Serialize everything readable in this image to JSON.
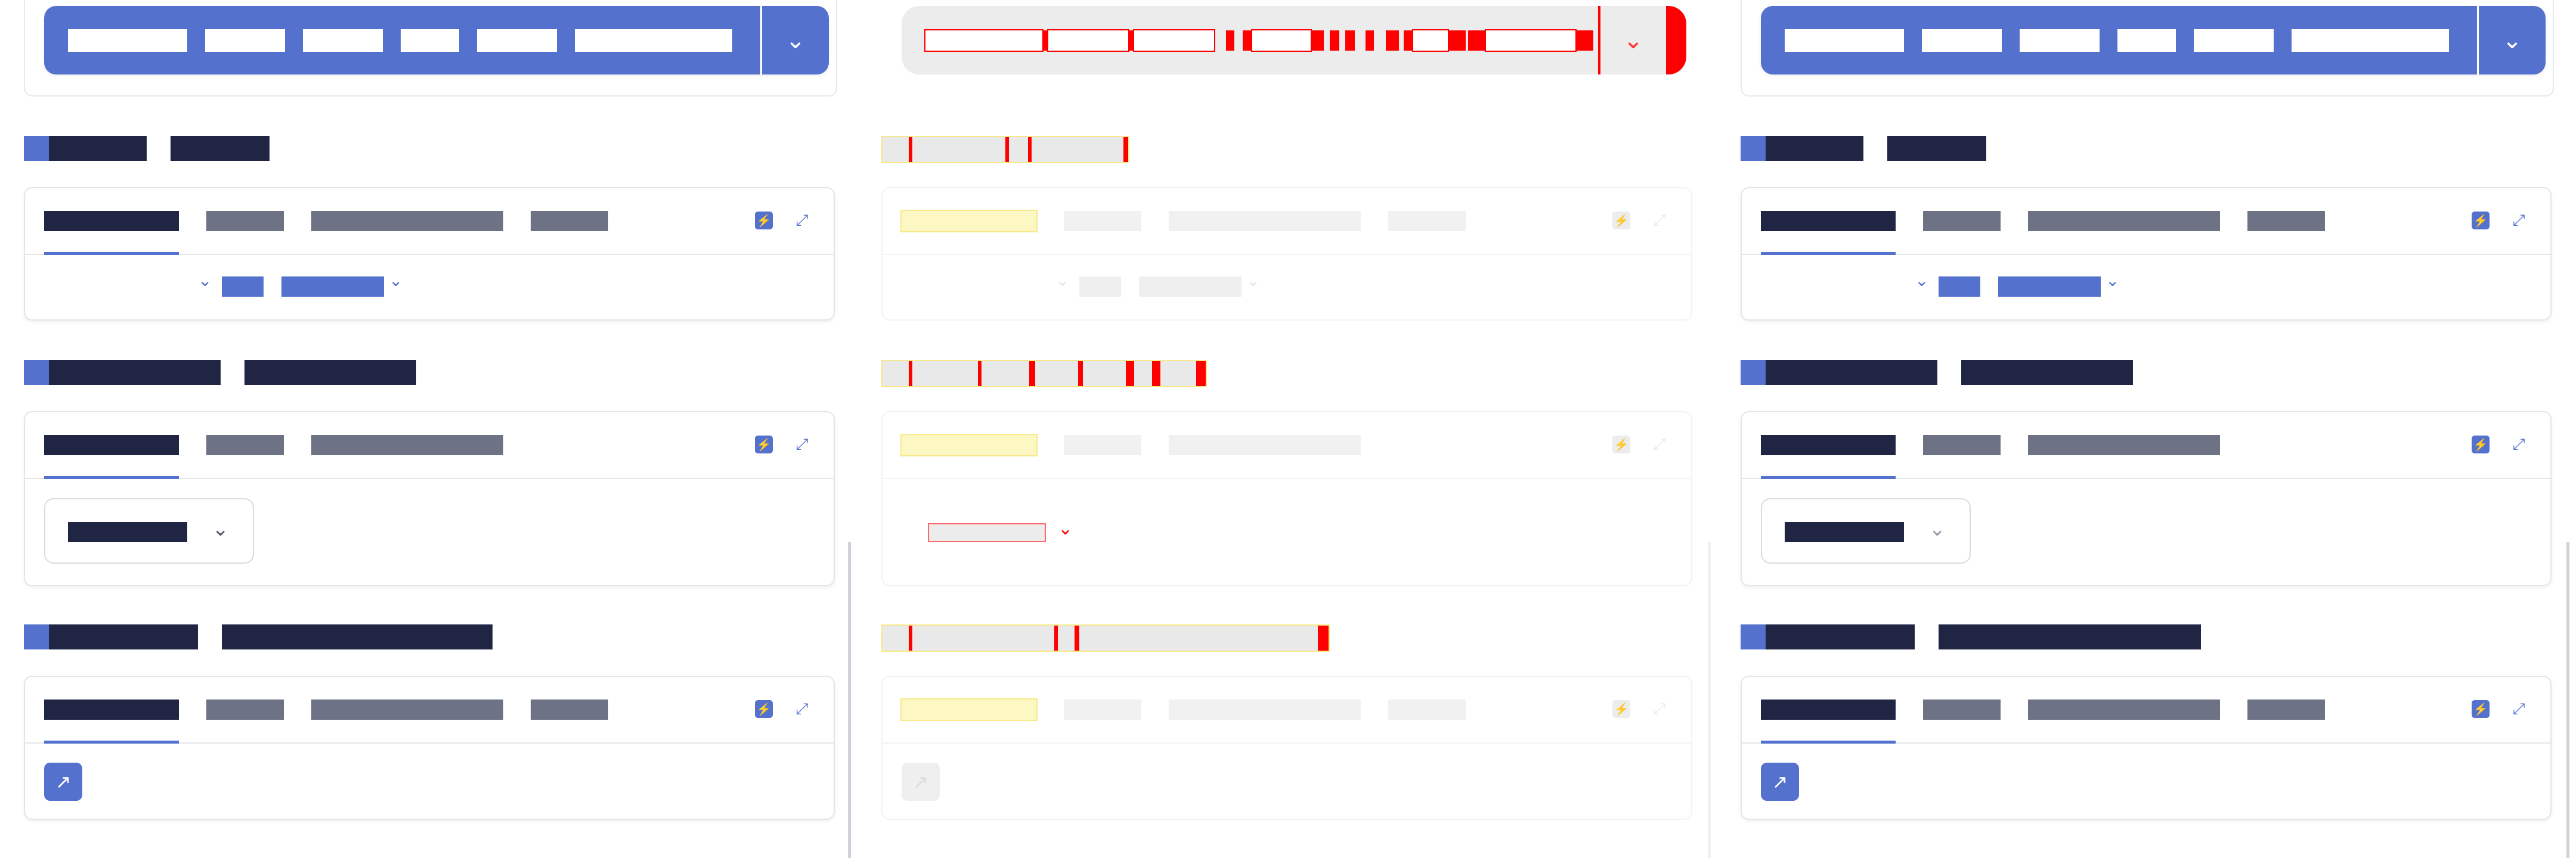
{
  "colors": {
    "accent": "#5471cd",
    "heading_text": "#1f2543",
    "muted_text": "#6d7285",
    "border": "#e3e5ea",
    "debug_red": "#ff0000",
    "debug_yellow": "#f7e98a"
  },
  "icons": {
    "split_caret": "chevron-down-icon",
    "bolt": "bolt-icon",
    "expand": "expand-icon",
    "select_caret": "chevron-down-icon",
    "link": "arrow-up-right-icon"
  },
  "glyphs": {
    "chevron": "⌄",
    "bolt": "⚡",
    "expand": "⤢",
    "link": "↗"
  },
  "columns": [
    {
      "id": "left",
      "variant": "normal"
    },
    {
      "id": "middle",
      "variant": "faded-debug"
    },
    {
      "id": "right",
      "variant": "normal"
    }
  ]
}
